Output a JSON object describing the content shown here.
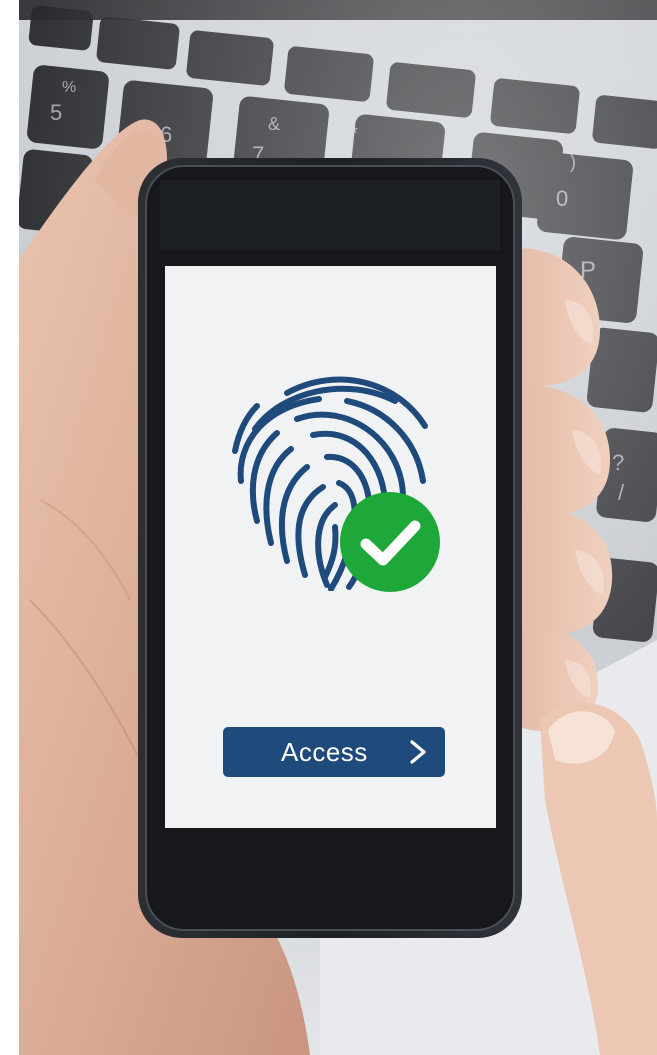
{
  "app": {
    "screen": {
      "action_button": {
        "label": "Access",
        "icon": "chevron-right-icon",
        "color": "#1e4a7c"
      },
      "status_icon": "fingerprint-icon",
      "success_badge": {
        "icon": "checkmark-icon",
        "color": "#1fa83a"
      },
      "accent_color": "#1e4a7c",
      "background_color": "#f1f2f3"
    }
  }
}
